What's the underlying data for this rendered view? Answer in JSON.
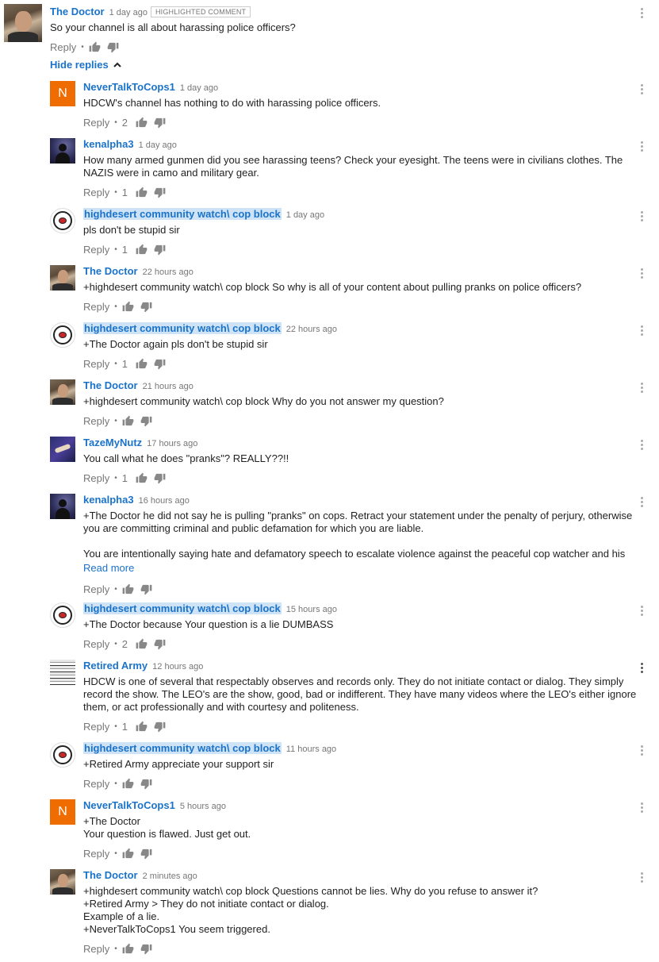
{
  "reply_label": "Reply",
  "read_more_label": "Read more",
  "hide_replies_label": "Hide replies",
  "highlight_badge": "HIGHLIGHTED COMMENT",
  "icons": {
    "like": "thumb-up-icon",
    "dislike": "thumb-down-icon",
    "more": "kebab-menu-icon",
    "collapse": "chevron-up-icon"
  },
  "colors": {
    "author_link": "#1a73c9",
    "highlight_bg": "#cfe3f7",
    "avatar_n": "#ef6c00",
    "meta_text": "#777777"
  },
  "top_comment": {
    "author": "The Doctor",
    "time": "1 day ago",
    "lines": [
      "So your channel is all about harassing police officers?"
    ]
  },
  "replies": [
    {
      "author": "NeverTalkToCops1",
      "time": "1 day ago",
      "likes": "2",
      "lines": [
        "HDCW's channel has nothing to do with harassing police officers."
      ]
    },
    {
      "author": "kenalpha3",
      "time": "1 day ago",
      "likes": "1",
      "lines": [
        "How many armed gunmen did you see harassing teens? Check your eyesight. The teens were in civilians clothes. The",
        "NAZIS were in camo and military gear."
      ]
    },
    {
      "author": "highdesert community watch\\ cop block",
      "time": "1 day ago",
      "likes": "1",
      "lines": [
        "pls don't be stupid sir"
      ]
    },
    {
      "author": "The Doctor",
      "time": "22 hours ago",
      "likes": "",
      "lines": [
        "+highdesert community watch\\ cop block So why is all of your content about pulling pranks on police officers?"
      ]
    },
    {
      "author": "highdesert community watch\\ cop block",
      "time": "22 hours ago",
      "likes": "1",
      "lines": [
        "+The Doctor again pls don't be  stupid sir"
      ]
    },
    {
      "author": "The Doctor",
      "time": "21 hours ago",
      "likes": "",
      "lines": [
        "+highdesert community watch\\ cop block Why do you not answer my question?"
      ]
    },
    {
      "author": "TazeMyNutz",
      "time": "17 hours ago",
      "likes": "1",
      "lines": [
        "You call what he does \"pranks\"? REALLY??!!"
      ]
    },
    {
      "author": "kenalpha3",
      "time": "16 hours ago",
      "likes": "",
      "lines": [
        "+The Doctor he did not say he is pulling \"pranks\" on cops. Retract your statement under the penalty of perjury, otherwise",
        "you are committing criminal and public defamation for which you are liable.",
        "",
        "You are intentionally saying hate and defamatory speech to escalate violence against the peaceful cop watcher and his"
      ]
    },
    {
      "author": "highdesert community watch\\ cop block",
      "time": "15 hours ago",
      "likes": "2",
      "lines": [
        "+The Doctor because Your question is a lie DUMBASS"
      ]
    },
    {
      "author": "Retired Army",
      "time": "12 hours ago",
      "likes": "1",
      "lines": [
        "HDCW is one of several that respectably observes and records only.  They do not initiate contact or dialog.  They simply",
        "record the show.  The LEO's are the show, good, bad or indifferent.  They have many videos where the LEO's either ignore",
        "them, or act professionally and with courtesy and politeness."
      ]
    },
    {
      "author": "highdesert community watch\\ cop block",
      "time": "11 hours ago",
      "likes": "",
      "lines": [
        "+Retired Army appreciate your support sir"
      ]
    },
    {
      "author": "NeverTalkToCops1",
      "time": "5 hours ago",
      "likes": "",
      "lines": [
        "+The Doctor",
        "Your question is flawed. Just get out."
      ]
    },
    {
      "author": "The Doctor",
      "time": "2 minutes ago",
      "likes": "",
      "lines": [
        "+highdesert community watch\\ cop block Questions cannot be lies. Why do you refuse to answer it?",
        "+Retired Army > They do not initiate contact or dialog.",
        "Example of a lie.",
        "+NeverTalkToCops1 You seem triggered."
      ]
    }
  ]
}
